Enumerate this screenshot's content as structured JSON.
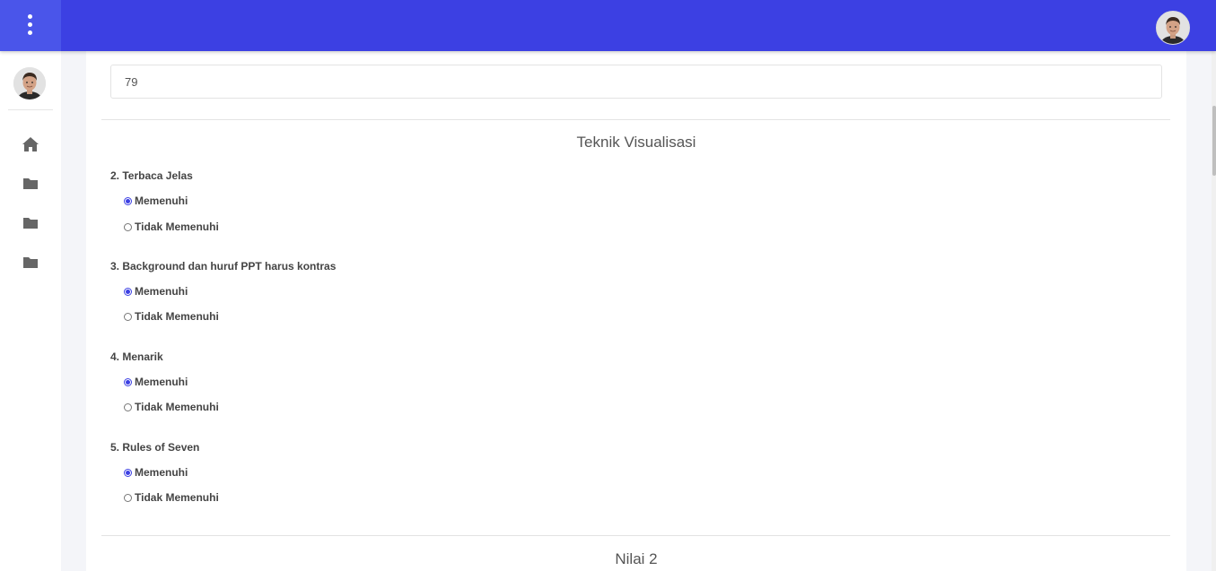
{
  "topbar": {
    "menu_icon": "kebab-vertical-icon",
    "user_avatar": "user-avatar",
    "brand_color": "#3c40e3"
  },
  "sidebar": {
    "user_avatar": "user-avatar",
    "items": [
      {
        "icon": "home-icon"
      },
      {
        "icon": "folder-icon"
      },
      {
        "icon": "folder-icon"
      },
      {
        "icon": "folder-icon"
      }
    ]
  },
  "form": {
    "score_value": "79",
    "section_title": "Teknik Visualisasi",
    "questions": [
      {
        "label": "2. Terbaca Jelas",
        "options": [
          "Memenuhi",
          "Tidak Memenuhi"
        ],
        "selected": "Memenuhi"
      },
      {
        "label": "3. Background dan huruf PPT harus kontras",
        "options": [
          "Memenuhi",
          "Tidak Memenuhi"
        ],
        "selected": "Memenuhi"
      },
      {
        "label": "4. Menarik",
        "options": [
          "Memenuhi",
          "Tidak Memenuhi"
        ],
        "selected": "Memenuhi"
      },
      {
        "label": "5. Rules of Seven",
        "options": [
          "Memenuhi",
          "Tidak Memenuhi"
        ],
        "selected": "Memenuhi"
      }
    ],
    "next_section_title": "Nilai 2"
  }
}
